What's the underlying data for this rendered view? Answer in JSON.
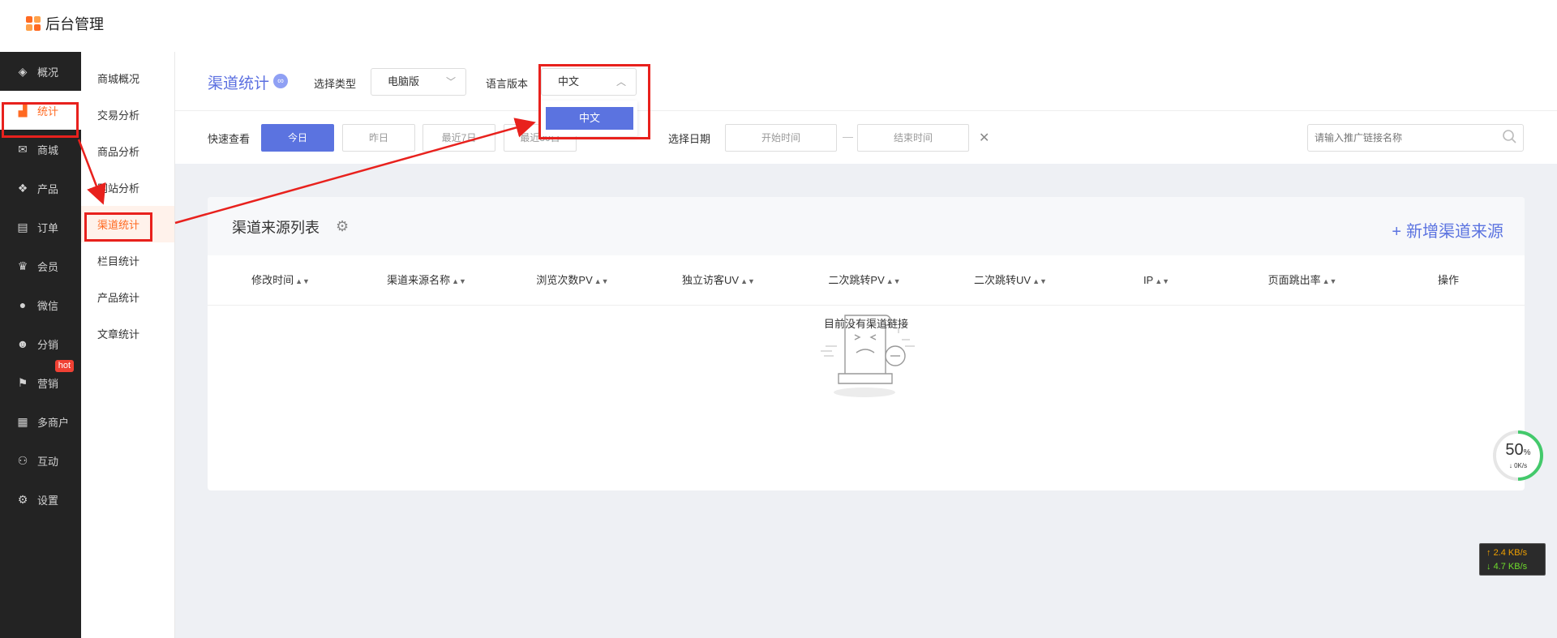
{
  "app": {
    "title": "后台管理"
  },
  "sidebar": {
    "items": [
      {
        "label": "概况",
        "icon": "layers-icon"
      },
      {
        "label": "统计",
        "icon": "chart-icon"
      },
      {
        "label": "商城",
        "icon": "mail-icon"
      },
      {
        "label": "产品",
        "icon": "apps-icon"
      },
      {
        "label": "订单",
        "icon": "clipboard-icon"
      },
      {
        "label": "会员",
        "icon": "crown-icon"
      },
      {
        "label": "微信",
        "icon": "chat-icon"
      },
      {
        "label": "分销",
        "icon": "user-share-icon"
      },
      {
        "label": "营销",
        "icon": "flag-icon",
        "badge": "hot"
      },
      {
        "label": "多商户",
        "icon": "store-icon"
      },
      {
        "label": "互动",
        "icon": "group-icon"
      },
      {
        "label": "设置",
        "icon": "gear-icon"
      }
    ],
    "active_index": 1
  },
  "subnav": {
    "items": [
      "商城概况",
      "交易分析",
      "商品分析",
      "网站分析",
      "渠道统计",
      "栏目统计",
      "产品统计",
      "文章统计"
    ],
    "active_index": 4
  },
  "filter": {
    "page_title": "渠道统计",
    "type_label": "选择类型",
    "type_value": "电脑版",
    "lang_label": "语言版本",
    "lang_value": "中文",
    "lang_options": [
      "中文"
    ],
    "quick_label": "快速查看",
    "quick_buttons": [
      "今日",
      "昨日",
      "最近7日",
      "最近30日"
    ],
    "date_label": "选择日期",
    "date_start_placeholder": "开始时间",
    "date_sep": "—",
    "date_end_placeholder": "结束时间",
    "search_placeholder": "请输入推广链接名称"
  },
  "card": {
    "title": "渠道来源列表",
    "add_label": "新增渠道来源",
    "columns": [
      "修改时间",
      "渠道来源名称",
      "浏览次数PV",
      "独立访客UV",
      "二次跳转PV",
      "二次跳转UV",
      "IP",
      "页面跳出率",
      "操作"
    ],
    "empty_text": "目前没有渠道链接"
  },
  "widget": {
    "percent": "50",
    "percent_unit": "%",
    "speed": "0K/s",
    "net_up": "2.4 KB/s",
    "net_down": "4.7 KB/s"
  },
  "colors": {
    "accent": "#5b73e0",
    "active": "#ff6a22",
    "annotation": "#e8211d"
  }
}
